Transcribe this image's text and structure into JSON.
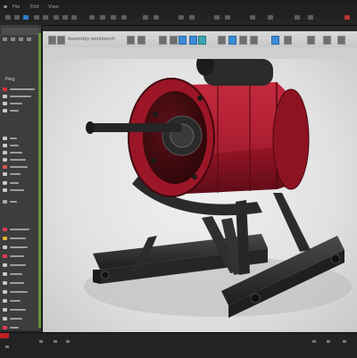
{
  "window": {
    "menu": [
      "File",
      "Edit",
      "View"
    ],
    "panel_title": "Pieg"
  },
  "toolbar": {
    "label": "Assembly workbench"
  },
  "colors": {
    "viewport_bg": "#e6e6e6",
    "part_red": "#a8172a",
    "frame_dark": "#2b2b2b",
    "accent_blue": "#2f7fc8"
  },
  "scene": {
    "object": "red cylindrical motor with shaft on dark steel stand"
  }
}
